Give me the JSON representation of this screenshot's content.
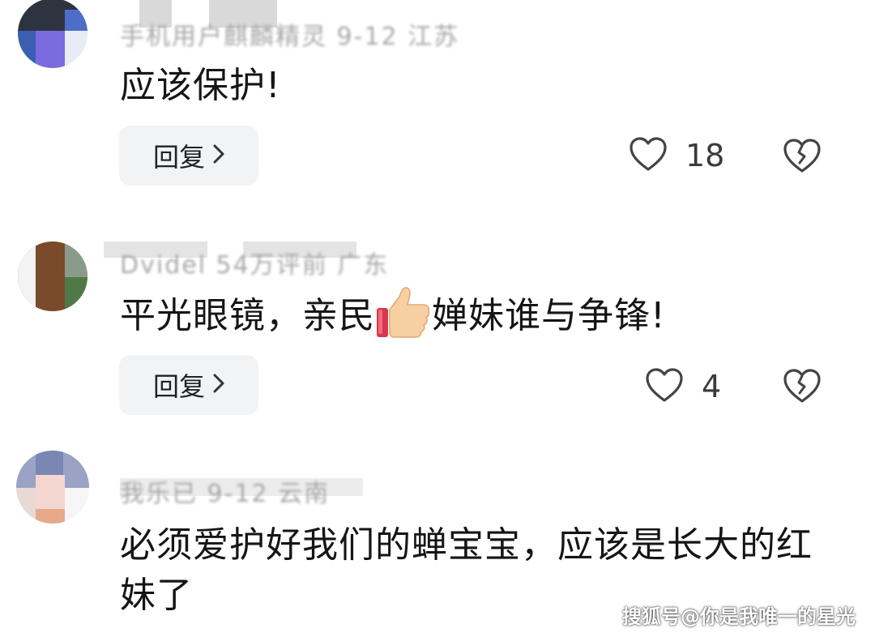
{
  "comments": [
    {
      "meta": "手机用户麒麟精灵  9-12  江苏",
      "text": "应该保护!",
      "reply_label": "回复",
      "likes": "18"
    },
    {
      "meta": "Dvidel  54万评前  广东",
      "text_before": "平光眼镜，亲民",
      "emoji": "thumbs-up",
      "text_after": "婵妹谁与争锋!",
      "reply_label": "回复",
      "likes": "4"
    },
    {
      "meta": "我乐已  9-12  云南",
      "text": "必须爱护好我们的蝉宝宝，应该是长大的红妹了"
    }
  ],
  "watermark": "搜狐号@你是我唯一的星光"
}
